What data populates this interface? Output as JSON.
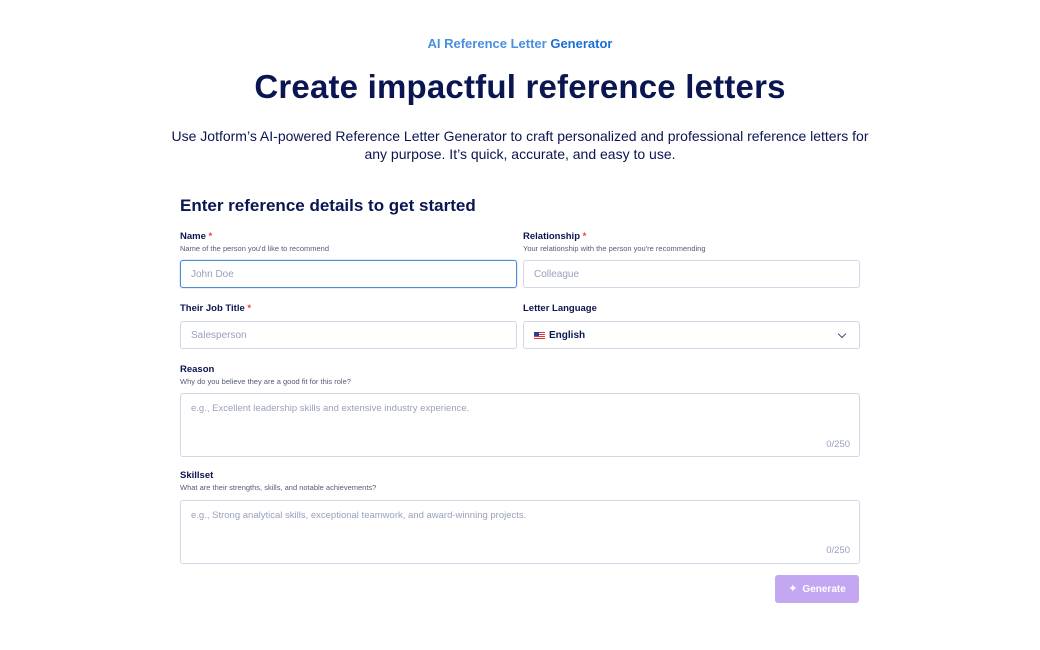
{
  "header": {
    "eyebrow_prefix": "AI Reference Letter",
    "eyebrow_strong": "Generator",
    "title": "Create impactful reference letters",
    "description_line1": "Use Jotform’s AI-powered Reference Letter Generator to craft personalized and professional reference letters for",
    "description_line2": "any purpose. It’s quick, accurate, and easy to use."
  },
  "form": {
    "title": "Enter reference details to get started",
    "required_mark": "*",
    "name": {
      "label": "Name",
      "hint": "Name of the person you'd like to recommend",
      "placeholder": "John Doe",
      "value": ""
    },
    "relationship": {
      "label": "Relationship",
      "hint": "Your relationship with the person you're recommending",
      "placeholder": "Colleague",
      "value": ""
    },
    "job_title": {
      "label": "Their Job Title",
      "placeholder": "Salesperson",
      "value": ""
    },
    "language": {
      "label": "Letter Language",
      "selected": "English",
      "flag_icon": "us-flag-icon"
    },
    "reason": {
      "label": "Reason",
      "hint": "Why do you believe they are a good fit for this role?",
      "placeholder": "e.g., Excellent leadership skills and extensive industry experience.",
      "counter": "0/250"
    },
    "skillset": {
      "label": "Skillset",
      "hint": "What are their strengths, skills, and notable achievements?",
      "placeholder": "e.g., Strong analytical skills, exceptional teamwork, and award-winning projects.",
      "counter": "0/250"
    },
    "generate": {
      "label": "Generate",
      "icon": "sparkle-icon",
      "color": "#c4a7f2",
      "disabled": true
    }
  },
  "colors": {
    "primary_text": "#0a1551",
    "accent_blue": "#1a6fd8",
    "required_red": "#e5423a",
    "focus_border": "#4b8cd9"
  }
}
